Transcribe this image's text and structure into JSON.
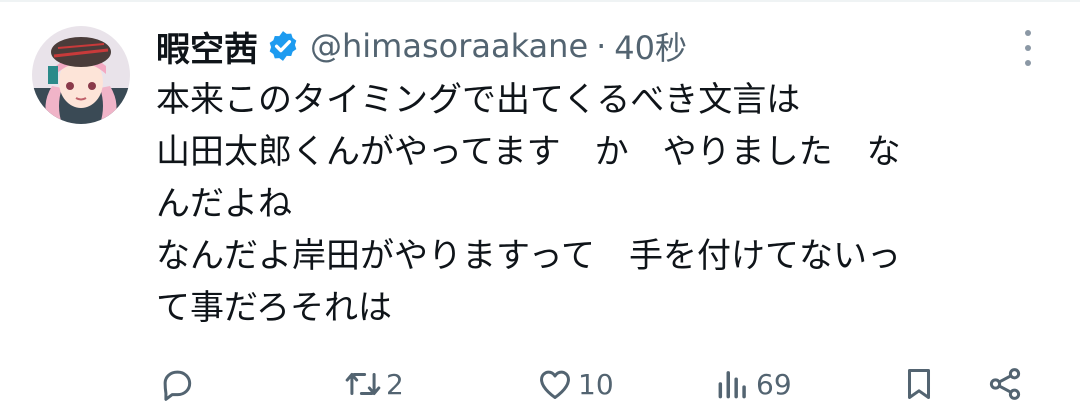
{
  "post": {
    "display_name": "暇空茜",
    "handle": "@himasoraakane",
    "separator": "·",
    "time": "40秒",
    "lines": [
      "本来このタイミングで出てくるべき文言は",
      "山田太郎くんがやってます　か　やりました　な",
      "んだよね",
      "なんだよ岸田がやりますって　手を付けてないっ",
      "て事だろそれは"
    ]
  },
  "actions": {
    "reply_count": "",
    "repost_count": "2",
    "like_count": "10",
    "views_count": "69"
  },
  "icons": {
    "avatar": "avatar-icon",
    "verified": "verified-badge-icon",
    "more": "more-icon",
    "reply": "reply-icon",
    "repost": "repost-icon",
    "like": "like-icon",
    "views": "views-icon",
    "bookmark": "bookmark-icon",
    "share": "share-icon"
  },
  "colors": {
    "verified": "#1d9bf0",
    "secondary_text": "#536471"
  }
}
